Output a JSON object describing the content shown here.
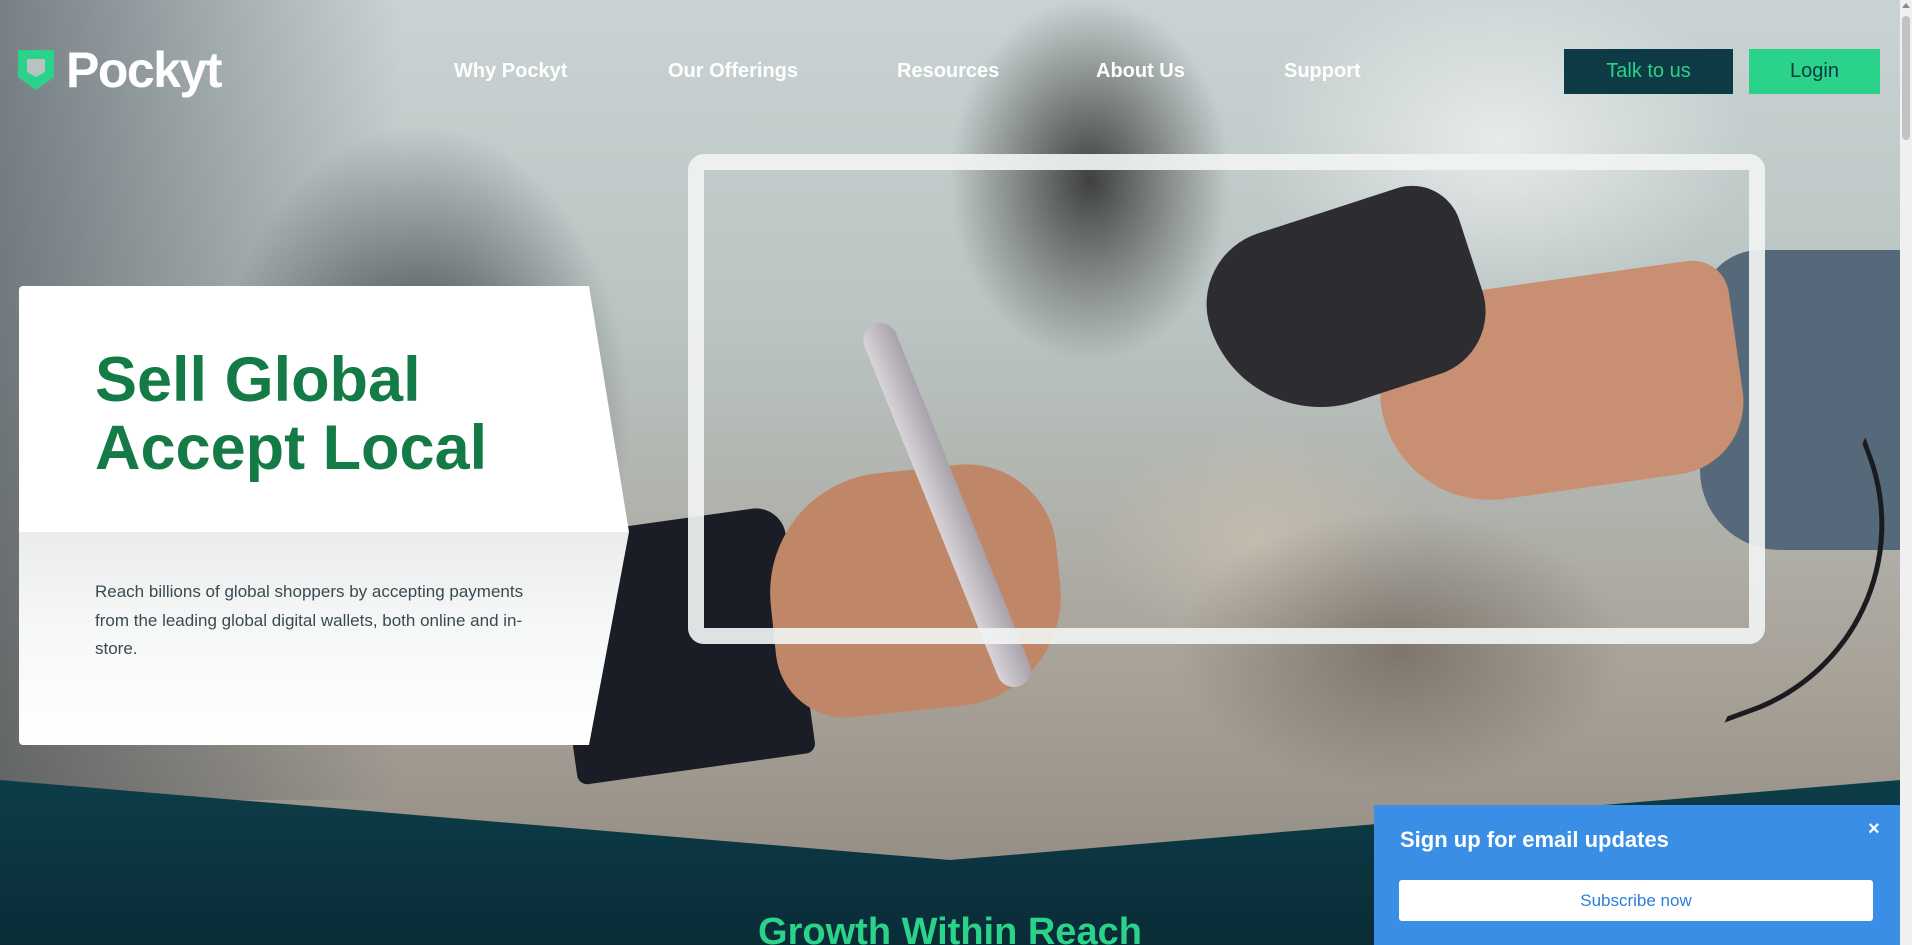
{
  "brand": {
    "name": "Pockyt",
    "logo_icon": "pocket-shield-icon"
  },
  "nav": {
    "items": [
      {
        "label": "Why Pockyt"
      },
      {
        "label": "Our Offerings"
      },
      {
        "label": "Resources"
      },
      {
        "label": "About Us"
      },
      {
        "label": "Support"
      }
    ]
  },
  "header": {
    "talk_label": "Talk to us",
    "login_label": "Login"
  },
  "hero": {
    "title_line1": "Sell Global",
    "title_line2": "Accept Local",
    "text": "Reach billions of global shoppers by accepting payments from the leading global digital wallets, both online and in-store."
  },
  "section": {
    "heading": "Growth Within Reach"
  },
  "popup": {
    "title": "Sign up for email updates",
    "close_glyph": "×",
    "subscribe_label": "Subscribe now"
  },
  "colors": {
    "brand_green": "#2ad28a",
    "dark_teal": "#0d3a45",
    "heading_green": "#147a46",
    "popup_blue": "#3a8ee6"
  }
}
